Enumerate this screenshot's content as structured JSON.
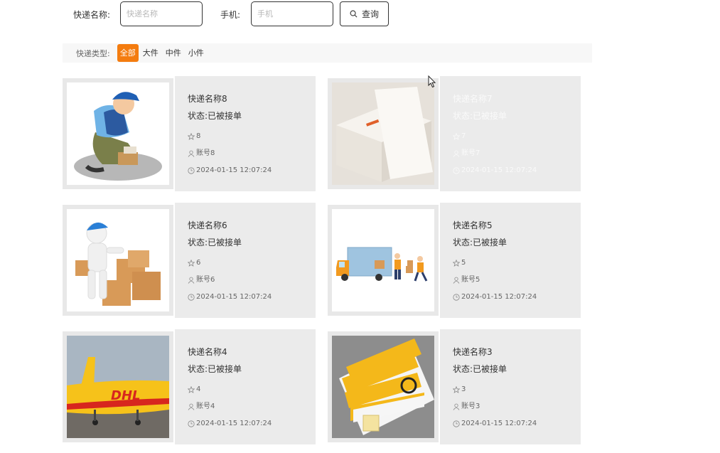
{
  "search": {
    "name_label": "快递名称:",
    "name_placeholder": "快递名称",
    "phone_label": "手机:",
    "phone_placeholder": "手机",
    "query_label": "查询"
  },
  "filter": {
    "label": "快递类型:",
    "options": [
      "全部",
      "大件",
      "中件",
      "小件"
    ],
    "selected": "全部"
  },
  "colors": {
    "accent": "#f47c0f"
  },
  "cards": [
    {
      "title": "快递名称8",
      "status": "状态:已被接单",
      "stars": "8",
      "account": "账号8",
      "time": "2024-01-15 12:07:24",
      "image": "courier-kneeling"
    },
    {
      "title": "快递名称7",
      "status": "状态:已被接单",
      "stars": "7",
      "account": "账号7",
      "time": "2024-01-15 12:07:24",
      "image": "paper-stack"
    },
    {
      "title": "快递名称6",
      "status": "状态:已被接单",
      "stars": "6",
      "account": "账号6",
      "time": "2024-01-15 12:07:24",
      "image": "figure-boxes"
    },
    {
      "title": "快递名称5",
      "status": "状态:已被接单",
      "stars": "5",
      "account": "账号5",
      "time": "2024-01-15 12:07:24",
      "image": "delivery-truck"
    },
    {
      "title": "快递名称4",
      "status": "状态:已被接单",
      "stars": "4",
      "account": "账号4",
      "time": "2024-01-15 12:07:24",
      "image": "dhl-plane"
    },
    {
      "title": "快递名称3",
      "status": "状态:已被接单",
      "stars": "3",
      "account": "账号3",
      "time": "2024-01-15 12:07:24",
      "image": "yunda-envelopes"
    }
  ]
}
